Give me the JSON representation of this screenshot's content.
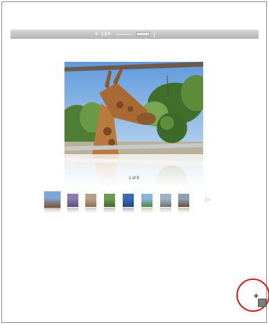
{
  "toolbar": {
    "prev_icon": "prev-icon",
    "play_icon": "pause-icon",
    "next_icon": "next-icon",
    "size_slider": "zoom-slider",
    "size_toggle": "size-toggle-icon"
  },
  "gallery": {
    "counter": "1 of 9",
    "current_index": 1,
    "total": 9,
    "next_arrow_icon": "chevron-right-icon"
  },
  "thumbnails": [
    {
      "name": "giraffe",
      "color_a": "#7aa6d6",
      "color_b": "#7a5232"
    },
    {
      "name": "purple-flowers",
      "color_a": "#8a7bb0",
      "color_b": "#5d4b80"
    },
    {
      "name": "pale-animal",
      "color_a": "#b7a08a",
      "color_b": "#8b6d50"
    },
    {
      "name": "green-garden",
      "color_a": "#6d9a4e",
      "color_b": "#3e6b2b"
    },
    {
      "name": "blue-lake",
      "color_a": "#3a68b0",
      "color_b": "#20457c"
    },
    {
      "name": "trees",
      "color_a": "#8ab5d9",
      "color_b": "#4f8a3a"
    },
    {
      "name": "grey-animal",
      "color_a": "#9fb2c4",
      "color_b": "#6e6e6e"
    },
    {
      "name": "bear",
      "color_a": "#8c9fb6",
      "color_b": "#6e4e32"
    }
  ],
  "cursor": {
    "move_icon": "move-cursor-icon",
    "handle_color": "#7c7c7c",
    "ring_color": "#d11b1b"
  }
}
